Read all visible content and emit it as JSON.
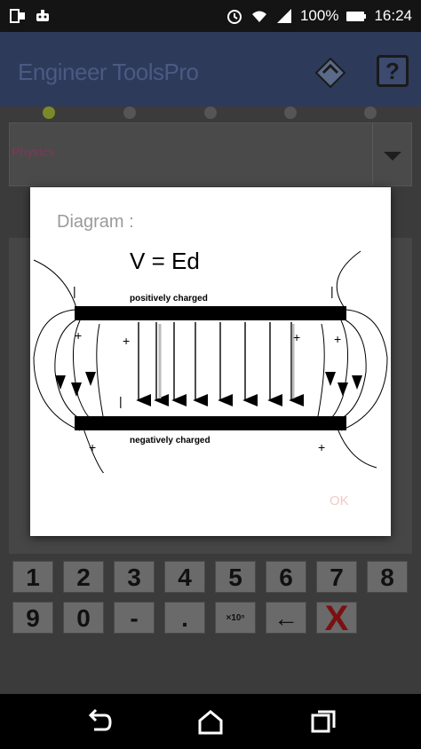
{
  "status_bar": {
    "battery_percent": "100%",
    "time": "16:24",
    "icons": [
      "screen-record-icon",
      "robot-icon",
      "alarm-icon",
      "wifi-icon",
      "signal-icon",
      "battery-icon"
    ]
  },
  "app_bar": {
    "title": "Engineer ToolsPro",
    "help_label": "?"
  },
  "pager": {
    "page_count": 5,
    "active_index": 0
  },
  "category_spinner": {
    "selected": "Physics"
  },
  "keypad": {
    "row1": [
      "1",
      "2",
      "3",
      "4",
      "5",
      "6",
      "7",
      "8"
    ],
    "row2": [
      "9",
      "0",
      "-",
      ".",
      "×10ⁿ",
      "←",
      "X"
    ]
  },
  "dialog": {
    "title": "Diagram :",
    "formula": "V = Ed",
    "top_plate_label": "positively charged",
    "bottom_plate_label": "negatively charged",
    "ok_label": "OK"
  },
  "colors": {
    "app_bar": "#2e3a5a",
    "app_title": "#4a5a84",
    "content_bg": "#3b3b3b",
    "ok_text": "#f4c8c8",
    "delete_x": "#7a1010"
  }
}
